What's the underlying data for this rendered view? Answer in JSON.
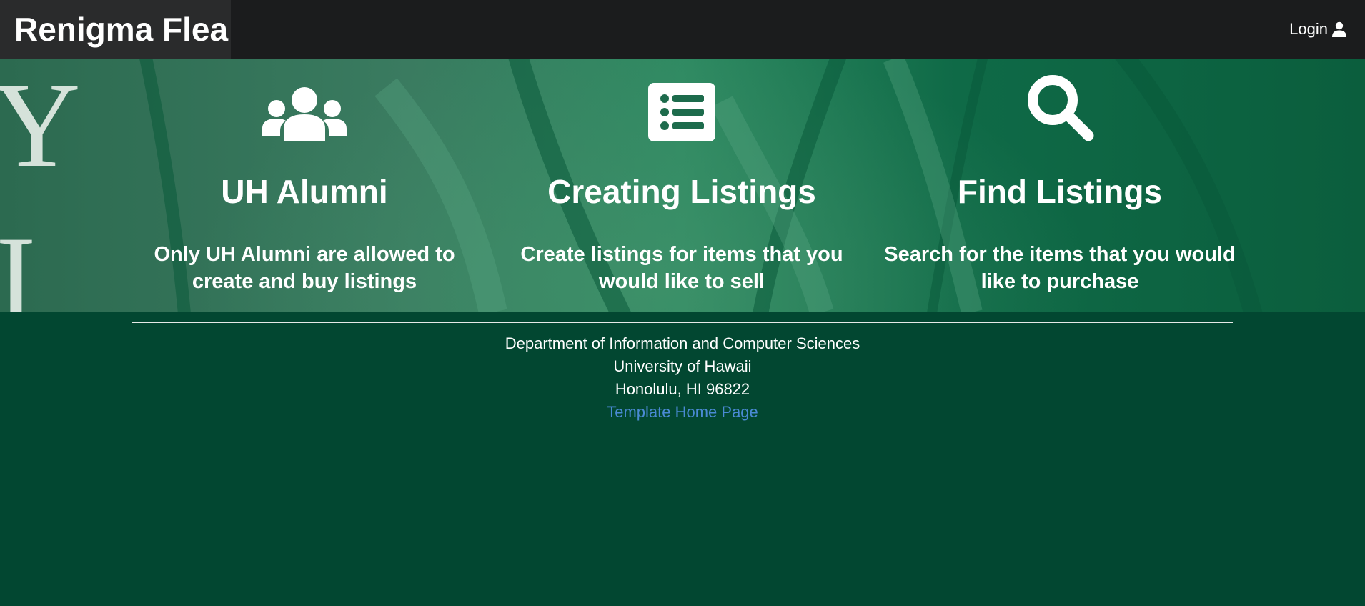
{
  "navbar": {
    "brand": "Renigma Flea",
    "login_label": "Login",
    "login_icon": "user-icon"
  },
  "features": [
    {
      "icon": "users-icon",
      "title": "UH Alumni",
      "line1": "Only UH Alumni are allowed to",
      "line2": "create and buy listings"
    },
    {
      "icon": "list-icon",
      "title": "Creating Listings",
      "line1": "Create listings for items that you",
      "line2": "would like to sell"
    },
    {
      "icon": "search-icon",
      "title": "Find Listings",
      "line1": "Search for the items that you would",
      "line2": "like to purchase"
    }
  ],
  "footer": {
    "line1": "Department of Information and Computer Sciences",
    "line2": "University of Hawaii",
    "line3": "Honolulu, HI 96822",
    "link": "Template Home Page"
  },
  "colors": {
    "navbar": "#1b1c1d",
    "brand_bg": "#2a2b2c",
    "page_bg": "#024731",
    "link": "#4a8ad4"
  }
}
